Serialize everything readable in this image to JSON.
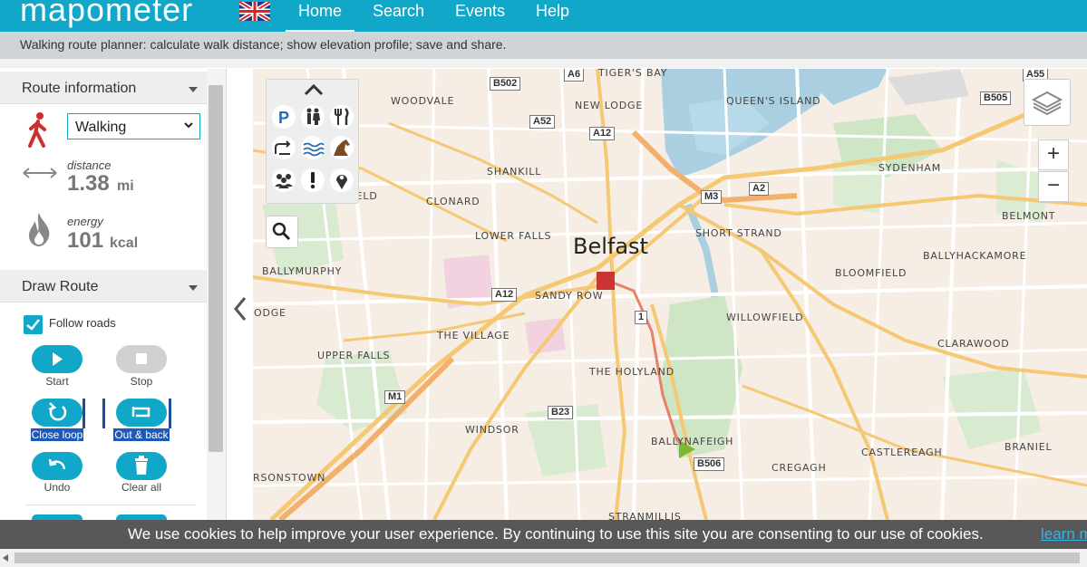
{
  "header": {
    "logo_text": "mapometer",
    "nav": [
      "Home",
      "Search",
      "Events",
      "Help"
    ],
    "subtitle": "Walking route planner: calculate walk distance; show elevation profile; save and share."
  },
  "route_info": {
    "section_title": "Route information",
    "mode": "Walking",
    "distance_label": "distance",
    "distance_value": "1.38",
    "distance_unit": "mi",
    "energy_label": "energy",
    "energy_value": "101",
    "energy_unit": "kcal"
  },
  "draw_route": {
    "section_title": "Draw Route",
    "follow_roads_label": "Follow roads",
    "follow_roads_checked": true,
    "buttons": {
      "start": "Start",
      "stop": "Stop",
      "close_loop": "Close loop",
      "out_back": "Out & back",
      "undo": "Undo",
      "clear_all": "Clear all"
    }
  },
  "map": {
    "city": "Belfast",
    "places": {
      "woodvale": "WOODVALE",
      "tigers_bay": "TIGER'S BAY",
      "new_lodge": "NEW LODGE",
      "queens_island": "QUEEN'S ISLAND",
      "shankill": "SHANKILL",
      "sydenham": "SYDENHAM",
      "highfield": "HIGHFIELD",
      "clonard": "CLONARD",
      "lower_falls": "LOWER FALLS",
      "short_strand": "SHORT STRAND",
      "belmont": "BELMONT",
      "ballymurphy": "BALLYMURPHY",
      "sandy_row": "SANDY ROW",
      "bloomfield": "BLOOMFIELD",
      "ballyhackamore": "BALLYHACKAMORE",
      "lodge": "ODGE",
      "willowfield": "WILLOWFIELD",
      "the_village": "THE VILLAGE",
      "upper_falls": "UPPER FALLS",
      "clarawood": "CLARAWOOD",
      "the_holyland": "THE HOLYLAND",
      "windsor": "WINDSOR",
      "ballynafeigh": "BALLYNAFEIGH",
      "castlereagh": "CASTLEREAGH",
      "braniel": "BRANIEL",
      "rsonstown": "RSONSTOWN",
      "creagh": "CREGAGH",
      "stranmillis": "STRANMILLIS"
    },
    "roads": {
      "b502": "B502",
      "a6": "A6",
      "a55": "A55",
      "b505": "B505",
      "a52": "A52",
      "a12_top": "A12",
      "m3": "M3",
      "a2": "A2",
      "a12_left": "A12",
      "r1": "1",
      "m1": "M1",
      "b23": "B23",
      "b506": "B506"
    },
    "route_color": "#e8735a",
    "start_marker_color": "#7cb82f",
    "end_marker_color": "#cc3333"
  },
  "cookie": {
    "text": "We use cookies to help improve your user experience. By continuing to use this site you are consenting to our use of cookies.",
    "link": "learn m"
  }
}
